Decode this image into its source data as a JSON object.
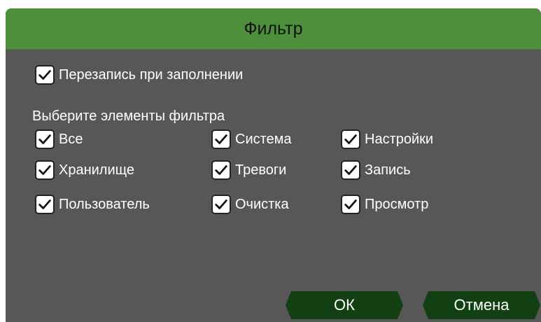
{
  "dialog": {
    "title": "Фильтр",
    "overwrite": {
      "label": "Перезапись при заполнении",
      "checked": true
    },
    "section_label": "Выберите элементы фильтра",
    "filters": [
      {
        "label": "Все",
        "checked": true
      },
      {
        "label": "Система",
        "checked": true
      },
      {
        "label": "Настройки",
        "checked": true
      },
      {
        "label": "Хранилище",
        "checked": true
      },
      {
        "label": "Тревоги",
        "checked": true
      },
      {
        "label": "Запись",
        "checked": true
      },
      {
        "label": "Пользователь",
        "checked": true
      },
      {
        "label": "Очистка",
        "checked": true
      },
      {
        "label": "Просмотр",
        "checked": true
      }
    ],
    "ok_label": "ОК",
    "cancel_label": "Отмена"
  },
  "colors": {
    "title_bar": "#4e8f3c",
    "panel": "#575757",
    "button": "#124012"
  }
}
